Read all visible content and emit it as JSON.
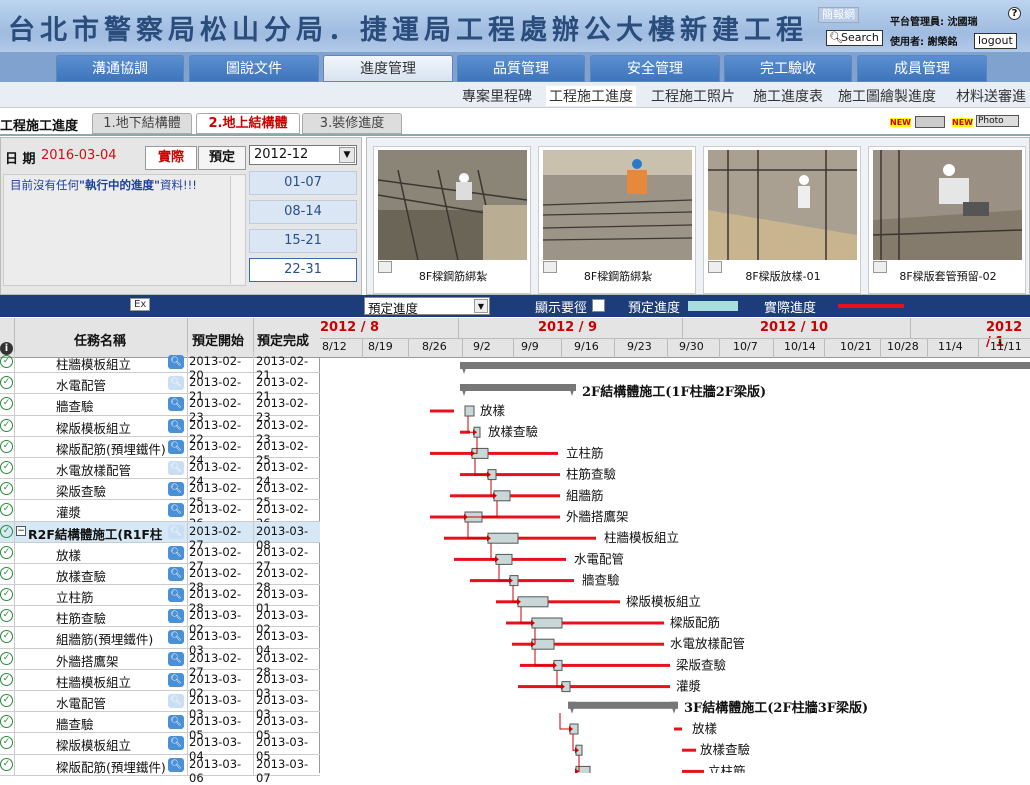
{
  "header": {
    "title": "台北市警察局松山分局．捷運局工程處辦公大樓新建工程",
    "report_button": "簡報網",
    "search_button": "Search",
    "admin_label": "平台管理員: 沈國瑞",
    "user_label": "使用者: 謝榮銘",
    "logout_button": "logout",
    "help_icon": "?"
  },
  "tabs": [
    "溝通協調",
    "圖說文件",
    "進度管理",
    "品質管理",
    "安全管理",
    "完工驗收",
    "成員管理"
  ],
  "active_tab": "進度管理",
  "subnav": [
    "專案里程碑",
    "工程施工進度",
    "工程施工照片",
    "施工進度表",
    "施工圖繪製進度",
    "材料送審進"
  ],
  "active_subnav": "工程施工進度",
  "section": {
    "title": "工程施工進度",
    "tabs": [
      "1.地下結構體",
      "2.地上結構體",
      "3.裝修進度"
    ],
    "new_label": "NEW",
    "photo_label": "Photo"
  },
  "left_panel": {
    "date_label": "日 期",
    "date_value": "2016-03-04",
    "actual_button": "實際",
    "planned_button": "預定",
    "month_select": "2012-12",
    "message_prefix": "目前沒有任何",
    "message_highlight": "\"執行中的進度\"",
    "message_suffix": "資料!!!",
    "week_buttons": [
      "01-07",
      "08-14",
      "15-21",
      "22-31"
    ]
  },
  "photos": [
    {
      "caption": "8F樑鋼筋綁紮"
    },
    {
      "caption": "8F樑鋼筋綁紮"
    },
    {
      "caption": "8F樑版放樣-01"
    },
    {
      "caption": "8F樑版套管預留-02"
    }
  ],
  "toolbar": {
    "export_label": "Ex",
    "select_value": "預定進度",
    "show_critical": "顯示要徑",
    "planned_legend": "預定進度",
    "actual_legend": "實際進度",
    "planned_color": "#a8dede",
    "actual_color": "#e8101a"
  },
  "grid": {
    "headers": {
      "info": "i",
      "name": "任務名稱",
      "start": "預定開始",
      "end": "預定完成"
    },
    "rows": [
      {
        "name": "柱牆模板組立",
        "start": "2013-02-20",
        "end": "2013-02-21",
        "group": false,
        "pale": false
      },
      {
        "name": "水電配管",
        "start": "2013-02-21",
        "end": "2013-02-21",
        "group": false,
        "pale": true
      },
      {
        "name": "牆查驗",
        "start": "2013-02-23",
        "end": "2013-02-23",
        "group": false,
        "pale": false
      },
      {
        "name": "樑版模板組立",
        "start": "2013-02-22",
        "end": "2013-02-23",
        "group": false,
        "pale": false
      },
      {
        "name": "樑版配筋(預埋鐵件)",
        "start": "2013-02-24",
        "end": "2013-02-25",
        "group": false,
        "pale": false
      },
      {
        "name": "水電放樣配管",
        "start": "2013-02-24",
        "end": "2013-02-24",
        "group": false,
        "pale": true
      },
      {
        "name": "梁版查驗",
        "start": "2013-02-25",
        "end": "2013-02-25",
        "group": false,
        "pale": false
      },
      {
        "name": "灌漿",
        "start": "2013-02-26",
        "end": "2013-02-26",
        "group": false,
        "pale": false
      },
      {
        "name": "R2F結構體施工(R1F柱",
        "start": "2013-02-27",
        "end": "2013-03-08",
        "group": true,
        "pale": true
      },
      {
        "name": "放樣",
        "start": "2013-02-27",
        "end": "2013-02-27",
        "group": false,
        "pale": false
      },
      {
        "name": "放樣查驗",
        "start": "2013-02-28",
        "end": "2013-02-28",
        "group": false,
        "pale": false
      },
      {
        "name": "立柱筋",
        "start": "2013-02-28",
        "end": "2013-03-01",
        "group": false,
        "pale": false
      },
      {
        "name": "柱筋查驗",
        "start": "2013-03-02",
        "end": "2013-03-02",
        "group": false,
        "pale": false
      },
      {
        "name": "組牆筋(預埋鐵件)",
        "start": "2013-03-03",
        "end": "2013-03-04",
        "group": false,
        "pale": false
      },
      {
        "name": "外牆搭鷹架",
        "start": "2013-02-27",
        "end": "2013-02-28",
        "group": false,
        "pale": false
      },
      {
        "name": "柱牆模板組立",
        "start": "2013-03-02",
        "end": "2013-03-03",
        "group": false,
        "pale": false
      },
      {
        "name": "水電配管",
        "start": "2013-03-03",
        "end": "2013-03-03",
        "group": false,
        "pale": true
      },
      {
        "name": "牆查驗",
        "start": "2013-03-05",
        "end": "2013-03-05",
        "group": false,
        "pale": false
      },
      {
        "name": "樑版模板組立",
        "start": "2013-03-04",
        "end": "2013-03-05",
        "group": false,
        "pale": false
      },
      {
        "name": "樑版配筋(預埋鐵件)",
        "start": "2013-03-06",
        "end": "2013-03-07",
        "group": false,
        "pale": false
      }
    ]
  },
  "gantt": {
    "months": [
      "2012 / 8",
      "2012 / 9",
      "2012 / 10",
      "2012 / 1"
    ],
    "weeks": [
      "8/12",
      "8/19",
      "8/26",
      "9/2",
      "9/9",
      "9/16",
      "9/23",
      "9/30",
      "10/7",
      "10/14",
      "10/21",
      "10/28",
      "11/4",
      "11/11"
    ],
    "groups": [
      "2F結構體施工(1F柱牆2F梁版)",
      "3F結構體施工(2F柱牆3F梁版)"
    ],
    "tasks_2f": [
      "放樣",
      "放樣查驗",
      "立柱筋",
      "柱筋查驗",
      "組牆筋",
      "外牆搭鷹架",
      "柱牆模板組立",
      "水電配管",
      "牆查驗",
      "樑版模板組立",
      "樑版配筋",
      "水電放樣配管",
      "梁版查驗",
      "灌漿"
    ],
    "tasks_3f": [
      "放樣",
      "放樣查驗",
      "立柱筋"
    ]
  }
}
